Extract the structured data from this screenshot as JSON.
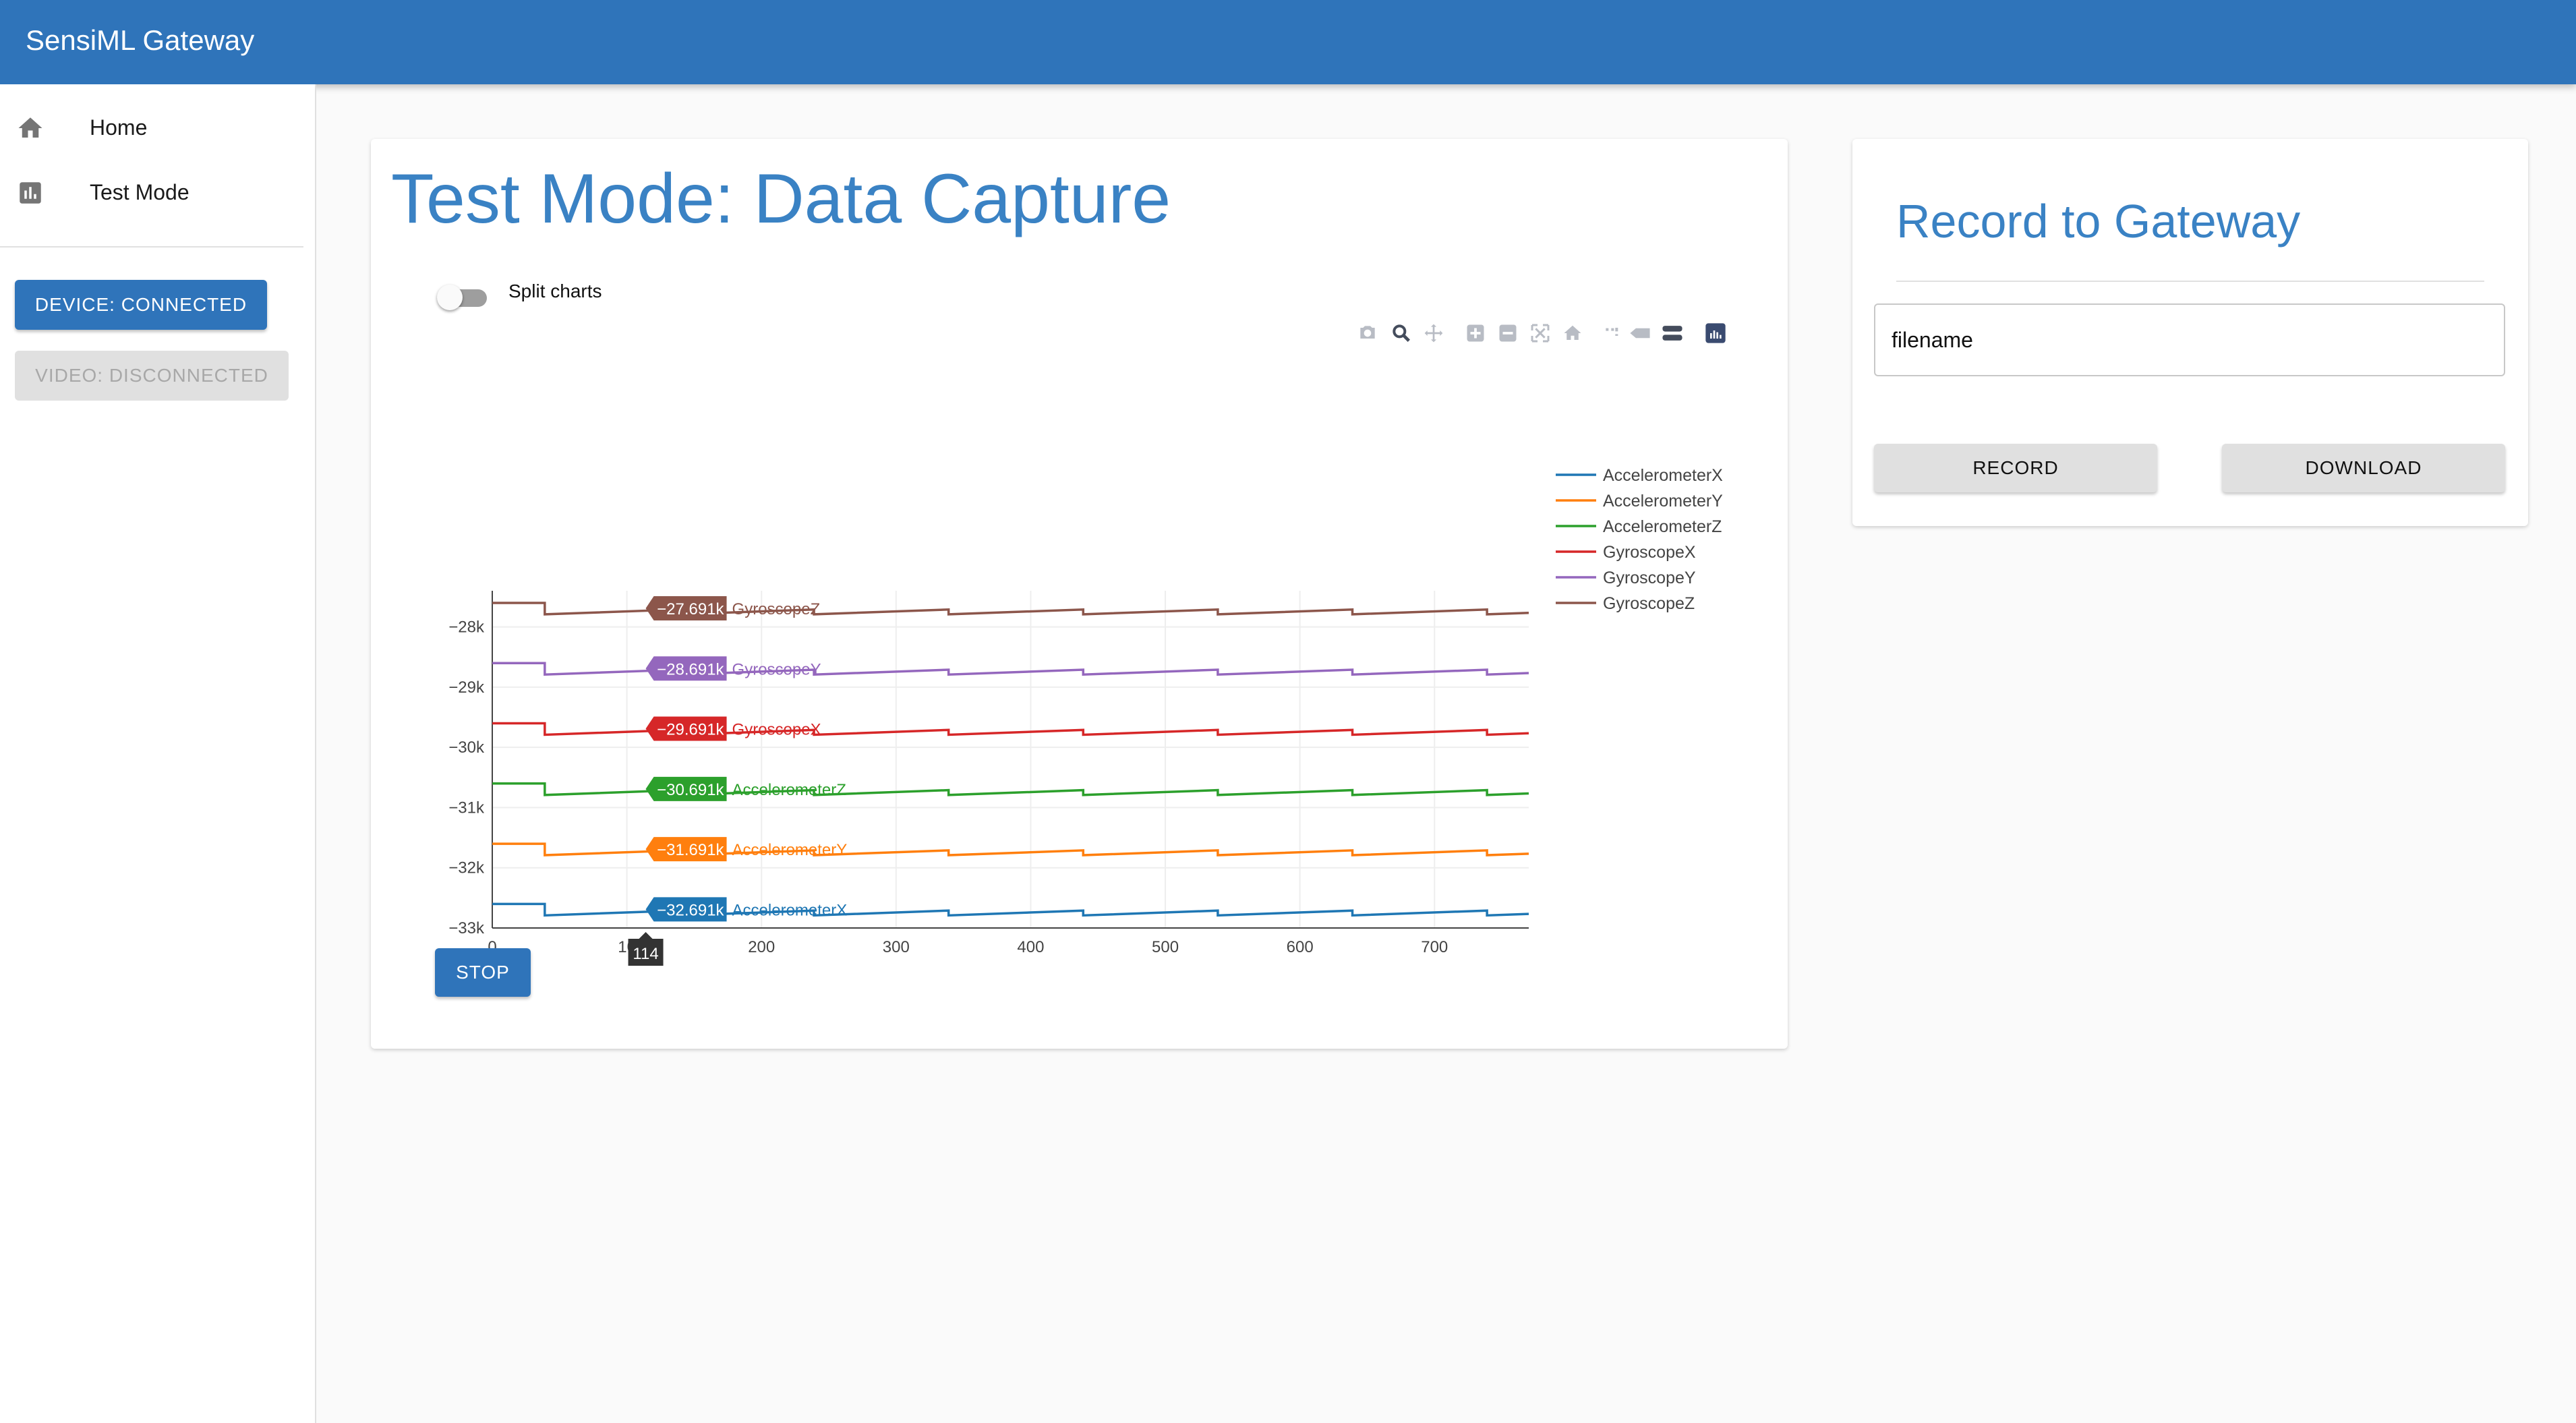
{
  "app": {
    "title": "SensiML Gateway"
  },
  "sidebar": {
    "items": [
      {
        "label": "Home",
        "icon": "home-icon"
      },
      {
        "label": "Test Mode",
        "icon": "bar-chart-icon"
      }
    ],
    "device_button": "DEVICE: CONNECTED",
    "video_button": "VIDEO: DISCONNECTED"
  },
  "main": {
    "title": "Test Mode: Data Capture",
    "split_toggle_label": "Split charts",
    "split_toggle_on": false,
    "stop_label": "STOP",
    "modebar_icons": [
      "camera-icon",
      "zoom-icon",
      "pan-icon",
      "zoom-in-icon",
      "zoom-out-icon",
      "autoscale-icon",
      "reset-axes-icon",
      "spike-lines-icon",
      "hover-closest-icon",
      "hover-compare-icon",
      "plotly-logo-icon"
    ]
  },
  "chart_data": {
    "type": "line",
    "x_range": [
      0,
      770
    ],
    "y_range": [
      -33000,
      -27400
    ],
    "x_ticks": [
      0,
      100,
      200,
      300,
      400,
      500,
      600,
      700
    ],
    "x_tick_labels": [
      "0",
      "10",
      "200",
      "300",
      "400",
      "500",
      "600",
      "700"
    ],
    "y_ticks": [
      -28000,
      -29000,
      -30000,
      -31000,
      -32000,
      -33000
    ],
    "y_tick_labels": [
      "−28k",
      "−29k",
      "−30k",
      "−31k",
      "−32k",
      "−33k"
    ],
    "hover_x": 114,
    "hover_x_label": "114",
    "grid": true,
    "legend_position": "right",
    "series": [
      {
        "name": "AccelerometerX",
        "color": "#1f77b4",
        "base": -32691,
        "hover_value": "−32.691k"
      },
      {
        "name": "AccelerometerY",
        "color": "#ff7f0e",
        "base": -31691,
        "hover_value": "−31.691k"
      },
      {
        "name": "AccelerometerZ",
        "color": "#2ca02c",
        "base": -30691,
        "hover_value": "−30.691k"
      },
      {
        "name": "GyroscopeX",
        "color": "#d62728",
        "base": -29691,
        "hover_value": "−29.691k"
      },
      {
        "name": "GyroscopeY",
        "color": "#9467bd",
        "base": -28691,
        "hover_value": "−28.691k"
      },
      {
        "name": "GyroscopeZ",
        "color": "#8c564b",
        "base": -27691,
        "hover_value": "−27.691k"
      }
    ],
    "segment_breaks": [
      0,
      39,
      139,
      239,
      339,
      439,
      539,
      639,
      739,
      770
    ],
    "drop_amount": 100,
    "rise_amount": 80
  },
  "record_panel": {
    "title": "Record to Gateway",
    "filename_placeholder": "filename",
    "record_label": "RECORD",
    "download_label": "DOWNLOAD"
  },
  "colors": {
    "primary": "#2f74ba",
    "title_blue": "#3a82c4"
  }
}
